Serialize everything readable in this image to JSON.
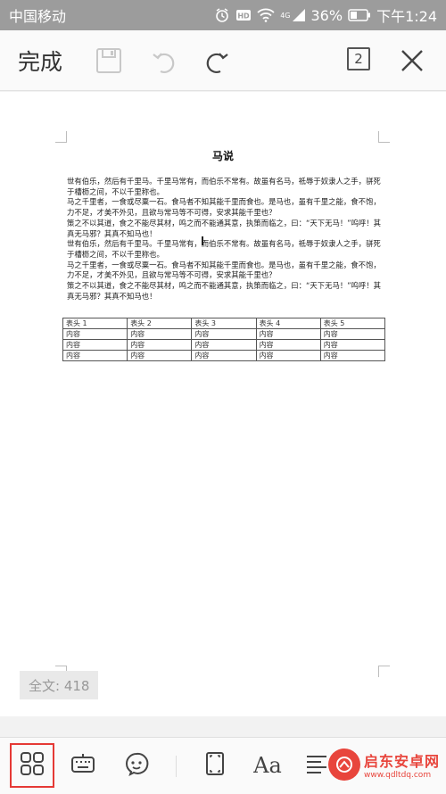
{
  "status_bar": {
    "carrier": "中国移动",
    "network": "4G",
    "battery": "36%",
    "time": "下午1:24"
  },
  "toolbar": {
    "done_label": "完成",
    "page_count": "2"
  },
  "document": {
    "title": "马说",
    "paragraphs": [
      "世有伯乐，然后有千里马。千里马常有，而伯乐不常有。故虽有名马，祗辱于奴隶人之手，骈死于槽枥之间，不以千里称也。",
      "马之千里者，一食或尽粟一石。食马者不知其能千里而食也。是马也，虽有千里之能，食不饱，力不足，才美不外见，且欲与常马等不可得，安求其能千里也？",
      "策之不以其道，食之不能尽其材，鸣之而不能通其意，执策而临之，曰：“天下无马！”呜呼！其真无马邪？其真不知马也！",
      "世有伯乐，然后有千里马。千里马常有，而伯乐不常有。故虽有名马，祗辱于奴隶人之手，骈死于槽枥之间，不以千里称也。",
      "马之千里者，一食或尽粟一石。食马者不知其能千里而食也。是马也，虽有千里之能，食不饱，力不足，才美不外见，且欲与常马等不可得，安求其能千里也？",
      "策之不以其道，食之不能尽其材，鸣之而不能通其意，执策而临之，曰：“天下无马！”呜呼！其真无马邪？其真不知马也！"
    ],
    "table": {
      "headers": [
        "表头 1",
        "表头 2",
        "表头 3",
        "表头 4",
        "表头 5"
      ],
      "rows": [
        [
          "内容",
          "内容",
          "内容",
          "内容",
          "内容"
        ],
        [
          "内容",
          "内容",
          "内容",
          "内容",
          "内容"
        ],
        [
          "内容",
          "内容",
          "内容",
          "内容",
          "内容"
        ]
      ]
    }
  },
  "word_count": "全文: 418",
  "bottom_bar": {
    "font_label": "Aa",
    "icons": [
      "grid-icon",
      "keyboard-icon",
      "voice-icon",
      "fullscreen-icon",
      "font-icon",
      "align-icon"
    ]
  },
  "watermark": {
    "name": "启东安卓网",
    "url": "www.qdltdq.com"
  },
  "colors": {
    "status_bar_bg": "#9c9c9c",
    "accent_red": "#e53935"
  }
}
